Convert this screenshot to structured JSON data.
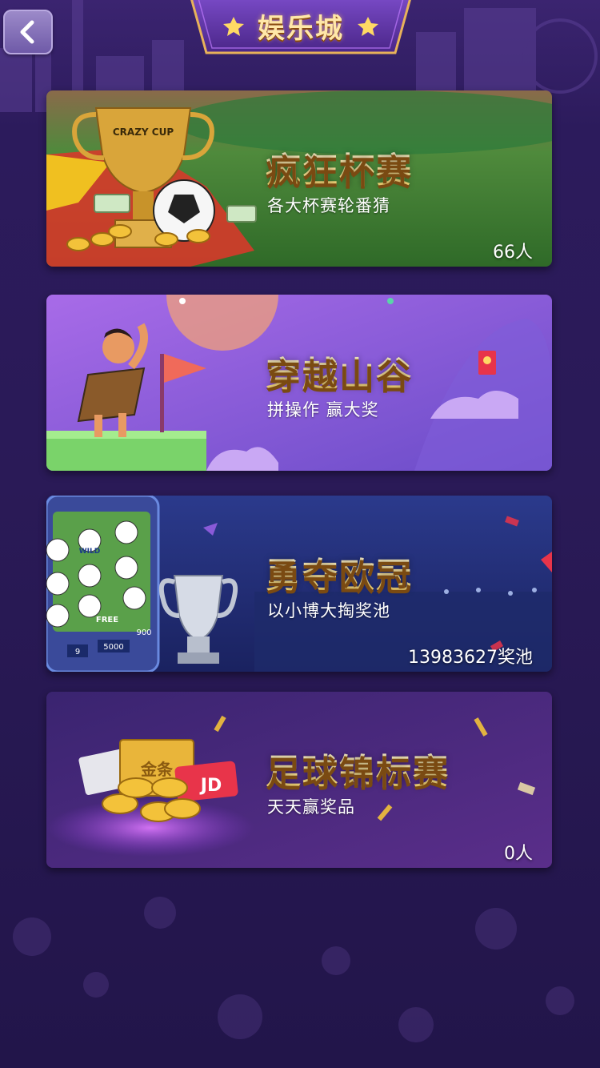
{
  "header": {
    "title": "娱乐城",
    "back_label": "返回"
  },
  "cards": [
    {
      "title": "疯狂杯赛",
      "subtitle": "各大杯赛轮番猜",
      "count": "66人"
    },
    {
      "title": "穿越山谷",
      "subtitle": "拼操作 赢大奖",
      "count": ""
    },
    {
      "title": "勇夺欧冠",
      "subtitle": "以小博大掏奖池",
      "count": "13983627奖池"
    },
    {
      "title": "足球锦标赛",
      "subtitle": "天天赢奖品",
      "count": "0人"
    }
  ],
  "decor": {
    "cup_text": "CRAZY CUP",
    "slot_wild": "WILD",
    "slot_free": "FREE",
    "slot_bet": "9",
    "slot_credit": "5000",
    "slot_side": "900",
    "gold_bar_text": "金条",
    "jd_text": "JD"
  },
  "icons": {
    "back": "chevron-left-icon",
    "star": "star-icon"
  },
  "colors": {
    "accent_gold": "#ffd964",
    "bg_purple": "#2a1a57"
  }
}
